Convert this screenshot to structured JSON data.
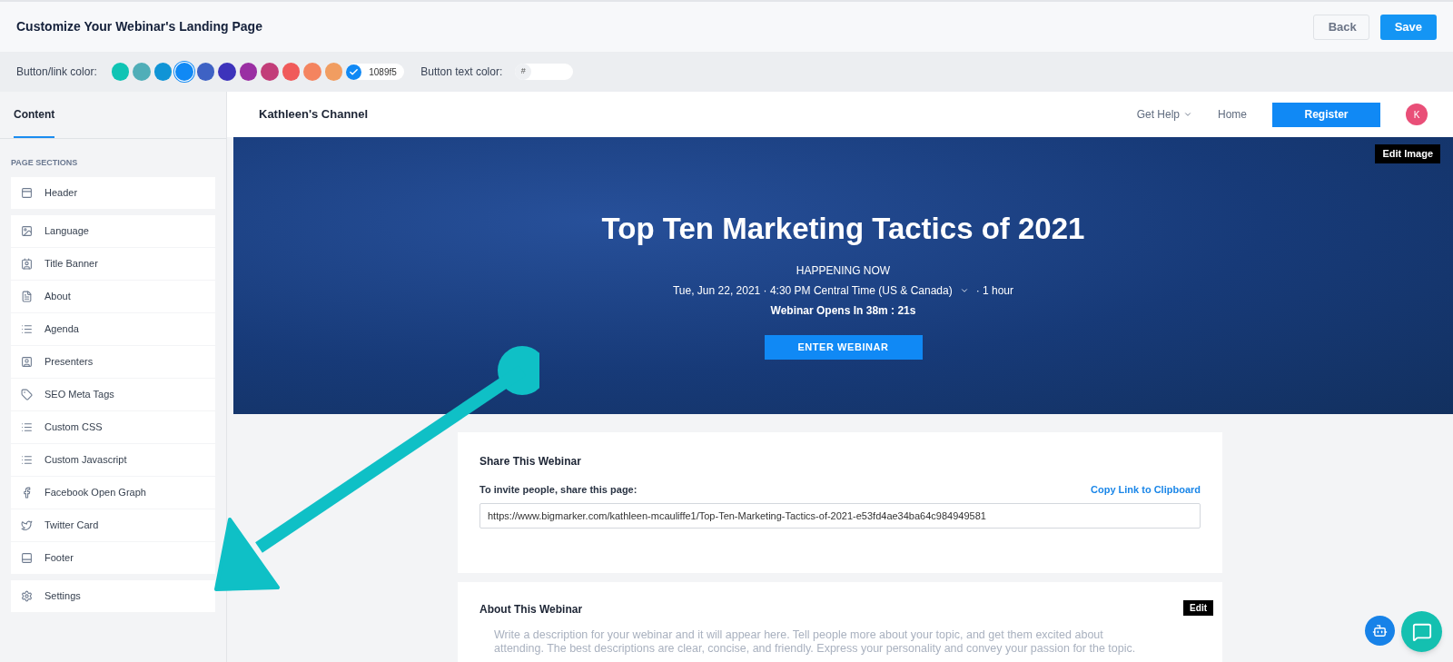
{
  "topbar": {
    "title": "Customize Your Webinar's Landing Page",
    "buttons": [
      {
        "label": "Back",
        "kind": "secondary"
      },
      {
        "label": "Save",
        "kind": "primary"
      }
    ]
  },
  "colorbar": {
    "link_label": "Button/link color:",
    "swatches": [
      {
        "color": "#10c4b4",
        "selected": false
      },
      {
        "color": "#50aeb8",
        "selected": false
      },
      {
        "color": "#1094d6",
        "selected": false
      },
      {
        "color": "#1089f5",
        "selected": true
      },
      {
        "color": "#3e62c4",
        "selected": false
      },
      {
        "color": "#3d33bb",
        "selected": false
      },
      {
        "color": "#9a2fa3",
        "selected": false
      },
      {
        "color": "#c23d79",
        "selected": false
      },
      {
        "color": "#f05a5a",
        "selected": false
      },
      {
        "color": "#f4845f",
        "selected": false
      },
      {
        "color": "#f19d61",
        "selected": false
      }
    ],
    "hex_value": "1089f5",
    "text_label": "Button text color:",
    "text_prefix": "#"
  },
  "sidebar": {
    "tabs": [
      {
        "label": "Content",
        "selected": true
      }
    ],
    "heading": "PAGE SECTIONS",
    "groups": [
      {
        "items": [
          "Header"
        ]
      },
      {
        "items": [
          "Language",
          "Title Banner",
          "About",
          "Agenda",
          "Presenters",
          "SEO Meta Tags",
          "Custom CSS",
          "Custom Javascript",
          "Facebook Open Graph",
          "Twitter Card",
          "Footer"
        ]
      },
      {
        "items": [
          "Settings"
        ]
      }
    ]
  },
  "preview": {
    "channel": "Kathleen's Channel",
    "nav": [
      {
        "label": "Get Help",
        "kind": "dropdown"
      },
      {
        "label": "Home",
        "kind": "link"
      }
    ],
    "register": "Register",
    "avatar": "K",
    "banner": {
      "edit": "Edit Image",
      "title": "Top Ten Marketing Tactics of 2021",
      "status": "HAPPENING NOW",
      "schedule": "Tue, Jun 22, 2021 · 4:30 PM Central Time (US & Canada)",
      "duration": "· 1 hour",
      "countdown": "Webinar Opens In 38m : 21s",
      "button": "ENTER WEBINAR"
    },
    "share": {
      "title": "Share This Webinar",
      "label": "To invite people, share this page:",
      "copy": "Copy Link to Clipboard",
      "url": "https://www.bigmarker.com/kathleen-mcauliffe1/Top-Ten-Marketing-Tactics-of-2021-e53fd4ae34ba64c984949581"
    },
    "about": {
      "title": "About This Webinar",
      "edit": "Edit",
      "placeholder_lines": [
        "Write a description for your webinar and it will appear here. Tell people more about your topic, and get them excited about",
        "attending. The best descriptions are clear, concise, and friendly. Express your personality and convey your passion for the topic."
      ]
    }
  }
}
